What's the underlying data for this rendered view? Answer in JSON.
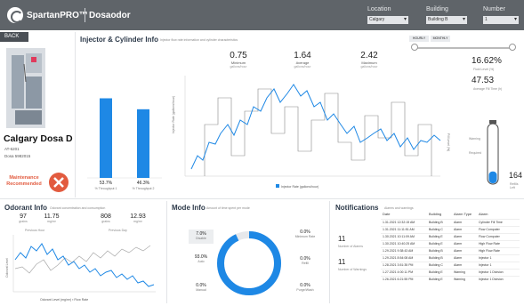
{
  "header": {
    "brand": "SpartanPRO™",
    "app_name": "Dosaodor",
    "filters": [
      {
        "label": "Location",
        "value": "Calgary"
      },
      {
        "label": "Building",
        "value": "Building B"
      },
      {
        "label": "Number",
        "value": "1"
      }
    ]
  },
  "sidebar": {
    "back_label": "BACK",
    "device_name": "Calgary Dosa D",
    "device_id": "AT-6201",
    "device_serial": "Dosa 5982015",
    "maintenance_status": "Maintenance Recommended"
  },
  "injector": {
    "title": "Injector & Cylinder Info",
    "subtitle": "Injector flow rate information and cylinder characteristics",
    "stats": [
      {
        "value": "0.75",
        "label": "Minimum",
        "unit": "gallons/hour"
      },
      {
        "value": "1.64",
        "label": "Average",
        "unit": "gallons/hour"
      },
      {
        "value": "2.42",
        "label": "Maximum",
        "unit": "gallons/hour"
      }
    ],
    "bars": [
      {
        "pct": "53.7%",
        "label": "% Throughput 1",
        "value": 0.537
      },
      {
        "pct": "46.3%",
        "label": "% Throughput 2",
        "value": 0.463
      }
    ],
    "chart_y_label": "Injector Rate (gallons/hour)",
    "chart_y2_label": "Fill Level (%)",
    "legend_label": "Injector Rate (gallons/hour)",
    "toggle_1": "HOURLY",
    "toggle_2": "MONTHLY",
    "fill_level": "16.62%",
    "fill_level_label": "Fluid Level (%)",
    "avg_fill": "47.53",
    "avg_fill_label": "Average Fill Time (h)",
    "cylinder_warning": "Warning",
    "cylinder_required": "Required",
    "cylinder_big": "164",
    "cylinder_big_label": "Refills Left",
    "gauge_value": 0.2
  },
  "odorant": {
    "title": "Odorant Info",
    "subtitle": "Odorant concentration and consumption",
    "stats": [
      {
        "value": "97",
        "unit": "grains"
      },
      {
        "value": "11.75",
        "unit": "mg/m³"
      },
      {
        "value": "808",
        "unit": "grains"
      },
      {
        "value": "12.93",
        "unit": "mg/m³"
      }
    ],
    "previous_hour": "Previous Hour",
    "previous_day": "Previous Day",
    "y_label": "Odorant Level",
    "legend": "Odorant Level (mg/m³)  ▪ Flow Rate"
  },
  "mode": {
    "title": "Mode Info",
    "subtitle": "Amount of time spent per mode",
    "items_left": [
      {
        "value": "7.0%",
        "label": "Disable"
      },
      {
        "value": "93.0%",
        "label": "Auto"
      },
      {
        "value": "0.0%",
        "label": "Manual"
      }
    ],
    "items_right": [
      {
        "value": "0.0%",
        "label": "Minimum Rate"
      },
      {
        "value": "0.0%",
        "label": "Refill"
      },
      {
        "value": "0.0%",
        "label": "Purge/Wash"
      }
    ],
    "donut_value": 0.93
  },
  "notifications": {
    "title": "Notifications",
    "subtitle": "Alarms and warnings",
    "alarms_count": "11",
    "alarms_label": "Number of Alarms",
    "warnings_count": "11",
    "warnings_label": "Number of Warnings",
    "columns": [
      "Date",
      "Building",
      "Alarm Type",
      "Alarm"
    ],
    "rows": [
      [
        "1.31.2021 12:32:15 AM",
        "Building B",
        "Alarm",
        "Cylinder Fill Time"
      ],
      [
        "1.31.2021 11:11:51 AM",
        "Building C",
        "Alarm",
        "Flow Computer"
      ],
      [
        "1.30.2021 10:11:09 AM",
        "Building E",
        "Alarm",
        "Flow Computer"
      ],
      [
        "1.30.2021 10:40:25 AM",
        "Building E",
        "Alarm",
        "High Flow Rate"
      ],
      [
        "1.29.2021 9:38:43 AM",
        "Building B",
        "Alarm",
        "High Flow Rate"
      ],
      [
        "1.29.2021 8:54:08 AM",
        "Building B",
        "Alarm",
        "Injector 1"
      ],
      [
        "1.28.2021 3:51:35 PM",
        "Building C",
        "Alarm",
        "Injector 1"
      ],
      [
        "1.27.2021 4:00:11 PM",
        "Building E",
        "Warning",
        "Injector 1 Division"
      ],
      [
        "1.26.2021 6:21:55 PM",
        "Building E",
        "Warning",
        "Injector 1 Division"
      ]
    ]
  },
  "colors": {
    "accent": "#1e88e5",
    "topbar": "#5f6469",
    "alert": "#e25b3f"
  }
}
